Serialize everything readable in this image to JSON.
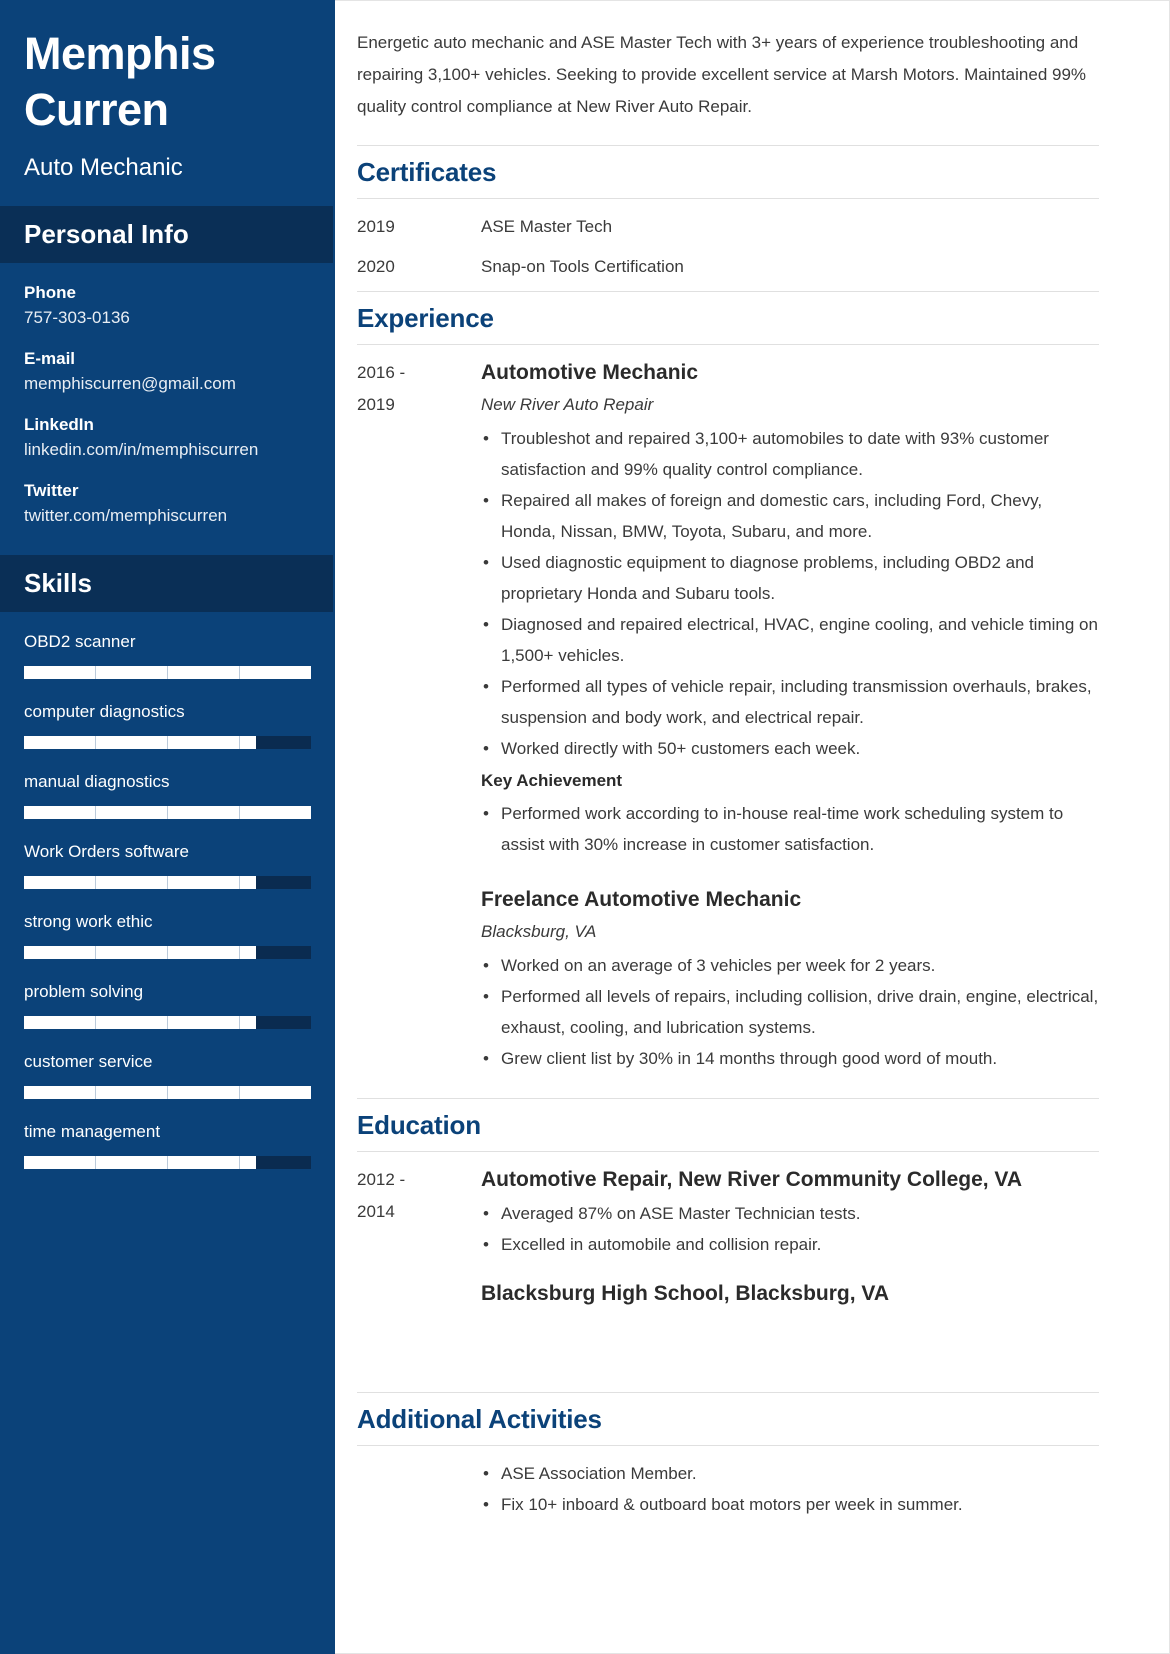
{
  "colors": {
    "sidebar_bg": "#0b4279",
    "sidebar_head_bg": "#0a2f56",
    "accent": "#0b4279",
    "skill_track": "#0a2b50",
    "skill_fill": "#ffffff",
    "body_text": "#3a3a3a"
  },
  "sidebar": {
    "name": "Memphis Curren",
    "job_title": "Auto Mechanic",
    "personal_info_heading": "Personal Info",
    "contacts": [
      {
        "label": "Phone",
        "value": "757-303-0136"
      },
      {
        "label": "E-mail",
        "value": "memphiscurren@gmail.com"
      },
      {
        "label": "LinkedIn",
        "value": "linkedin.com/in/memphiscurren"
      },
      {
        "label": "Twitter",
        "value": "twitter.com/memphiscurren"
      }
    ],
    "skills_heading": "Skills",
    "skills": [
      {
        "name": "OBD2 scanner",
        "level": 100
      },
      {
        "name": "computer diagnostics",
        "level": 81
      },
      {
        "name": "manual diagnostics",
        "level": 100
      },
      {
        "name": "Work Orders software",
        "level": 81
      },
      {
        "name": "strong work ethic",
        "level": 81
      },
      {
        "name": "problem solving",
        "level": 81
      },
      {
        "name": "customer service",
        "level": 100
      },
      {
        "name": "time management",
        "level": 81
      }
    ]
  },
  "main": {
    "summary": "Energetic auto mechanic and ASE Master Tech with 3+ years of experience troubleshooting and repairing 3,100+ vehicles. Seeking to provide excellent service at Marsh Motors. Maintained 99% quality control compliance at New River Auto Repair.",
    "certificates": {
      "heading": "Certificates",
      "items": [
        {
          "year": "2019",
          "name": "ASE Master Tech"
        },
        {
          "year": "2020",
          "name": "Snap-on Tools Certification"
        }
      ]
    },
    "experience": {
      "heading": "Experience",
      "entries": [
        {
          "date": "2016 -\n2019",
          "title": "Automotive Mechanic",
          "subtitle": "New River Auto Repair",
          "bullets": [
            "Troubleshot and repaired 3,100+ automobiles to date with 93% customer satisfaction and 99% quality control compliance.",
            "Repaired all makes of foreign and domestic cars, including Ford, Chevy, Honda, Nissan, BMW, Toyota, Subaru, and more.",
            "Used diagnostic equipment to diagnose problems, including OBD2 and proprietary Honda and Subaru tools.",
            "Diagnosed and repaired electrical, HVAC, engine cooling, and vehicle timing on 1,500+ vehicles.",
            "Performed all types of vehicle repair, including transmission overhauls, brakes, suspension and body work, and electrical repair.",
            "Worked directly with 50+ customers each week."
          ],
          "achievement_label": "Key Achievement",
          "achievement_bullets": [
            "Performed work according to in-house real-time work scheduling system to assist with 30% increase in customer satisfaction."
          ]
        },
        {
          "date": "",
          "title": "Freelance Automotive Mechanic",
          "subtitle": "Blacksburg, VA",
          "bullets": [
            "Worked on an average of 3 vehicles per week for 2 years.",
            "Performed all levels of repairs, including collision, drive drain, engine, electrical, exhaust, cooling, and lubrication systems.",
            "Grew client list by 30% in 14 months through good word of mouth."
          ],
          "achievement_label": "",
          "achievement_bullets": []
        }
      ]
    },
    "education": {
      "heading": "Education",
      "date": "2012 -\n2014",
      "title": "Automotive Repair, New River Community College, VA",
      "bullets": [
        "Averaged 87% on ASE Master Technician tests.",
        "Excelled in automobile and collision repair."
      ],
      "secondary": "Blacksburg High School, Blacksburg, VA"
    },
    "additional": {
      "heading": "Additional Activities",
      "bullets": [
        "ASE Association Member.",
        "Fix 10+ inboard & outboard boat motors per week in summer."
      ]
    }
  }
}
